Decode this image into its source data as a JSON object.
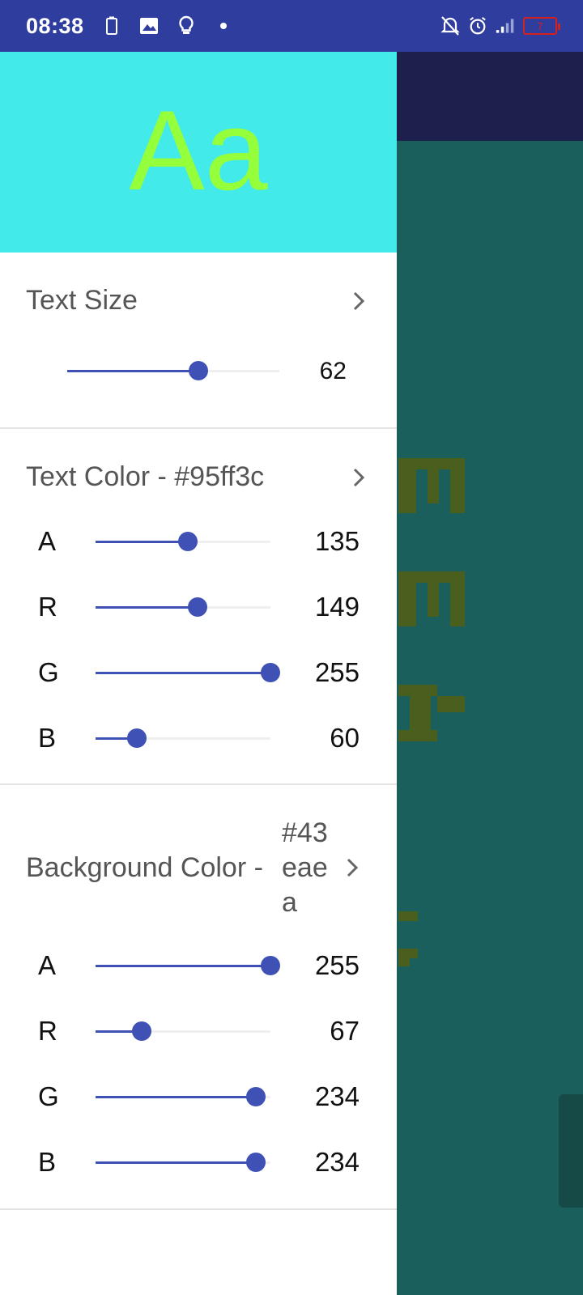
{
  "status_bar": {
    "time": "08:38",
    "battery_level": "7",
    "left_icons": [
      "battery-outline-icon",
      "image-icon",
      "lightbulb-icon",
      "dot-icon"
    ],
    "right_icons": [
      "notifications-off-icon",
      "alarm-icon",
      "signal-icon",
      "battery-icon"
    ]
  },
  "preview": {
    "sample_text": "Aa",
    "text_color": "#95ff3c",
    "background_color": "#43eaea"
  },
  "text_size": {
    "label": "Text Size",
    "value": "62",
    "slider_fraction": 0.62
  },
  "text_color": {
    "label": "Text Color - #95ff3c",
    "channels": [
      {
        "name": "A",
        "value": "135",
        "fraction": 0.53
      },
      {
        "name": "R",
        "value": "149",
        "fraction": 0.584
      },
      {
        "name": "G",
        "value": "255",
        "fraction": 1.0
      },
      {
        "name": "B",
        "value": "60",
        "fraction": 0.235
      }
    ]
  },
  "background_color": {
    "label_main": "Background Color -",
    "label_hex_lines": [
      "#43",
      "eae",
      "a"
    ],
    "channels": [
      {
        "name": "A",
        "value": "255",
        "fraction": 1.0
      },
      {
        "name": "R",
        "value": "67",
        "fraction": 0.263
      },
      {
        "name": "G",
        "value": "234",
        "fraction": 0.918
      },
      {
        "name": "B",
        "value": "234",
        "fraction": 0.918
      }
    ]
  },
  "colors": {
    "accent": "#3f51b5",
    "status_bar": "#2f3e9e",
    "background_app_toolbar": "#1d1f4c",
    "background_app_content": "#1b5f5c"
  }
}
